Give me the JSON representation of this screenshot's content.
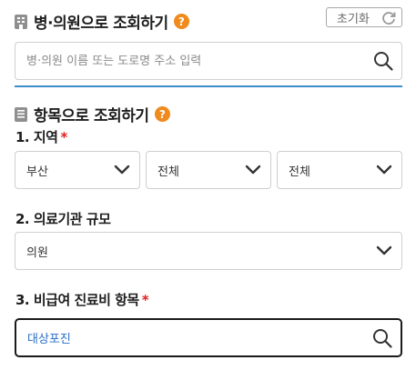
{
  "name_search": {
    "title": "병·의원으로 조회하기",
    "help": "?",
    "reset_label": "초기화",
    "placeholder": "병·의원 이름 또는 도로명 주소 입력"
  },
  "item_search": {
    "title": "항목으로 조회하기",
    "help": "?",
    "region": {
      "label": "1. 지역",
      "required_mark": "*",
      "selects": [
        "부산",
        "전체",
        "전체"
      ]
    },
    "scale": {
      "label": "2. 의료기관 규모",
      "value": "의원"
    },
    "item": {
      "label": "3. 비급여 진료비 항목",
      "required_mark": "*",
      "value": "대상포진"
    }
  },
  "colors": {
    "accent_line": "#3a8fcc",
    "help_icon": "#f08a1c",
    "required": "#e02020",
    "typed_text": "#2a6fc7"
  }
}
